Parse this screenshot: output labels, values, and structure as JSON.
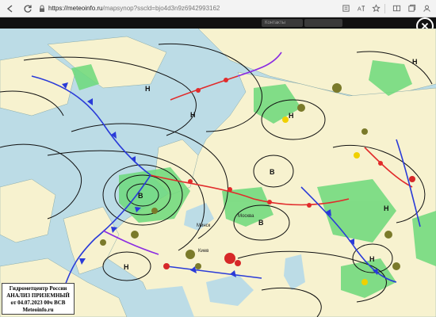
{
  "browser": {
    "url_host": "https://meteoinfo.ru",
    "url_path": "/mapsynop?sscld=bjo4d3n9z6942993162",
    "icons": [
      "back-icon",
      "refresh-icon",
      "lock-icon",
      "reader-view-icon",
      "translate-icon",
      "favorite-icon",
      "split-screen-icon",
      "collections-icon",
      "profile-icon"
    ]
  },
  "viewer": {
    "tabs": [
      "Контакты",
      ""
    ],
    "close_icon": "close-icon"
  },
  "map": {
    "description_colors": {
      "sea": "#bcdce6",
      "land": "#f7f2cf",
      "precip": "#6cd97a",
      "warm_front": "#e12b2b",
      "cold_front": "#2a3bd8",
      "occluded_front": "#8a2be2",
      "isobar": "#111111"
    },
    "pressure_labels": {
      "high": "Н",
      "low": "В"
    },
    "town_labels": [
      "Москва",
      "Киев",
      "Минск"
    ]
  },
  "caption": {
    "line1": "Гидрометцентр России",
    "line2": "АНАЛИЗ ПРИЗЕМНЫЙ",
    "line3": "от 04.07.2023 00ч ВСВ",
    "line4": "Meteoinfo.ru"
  }
}
